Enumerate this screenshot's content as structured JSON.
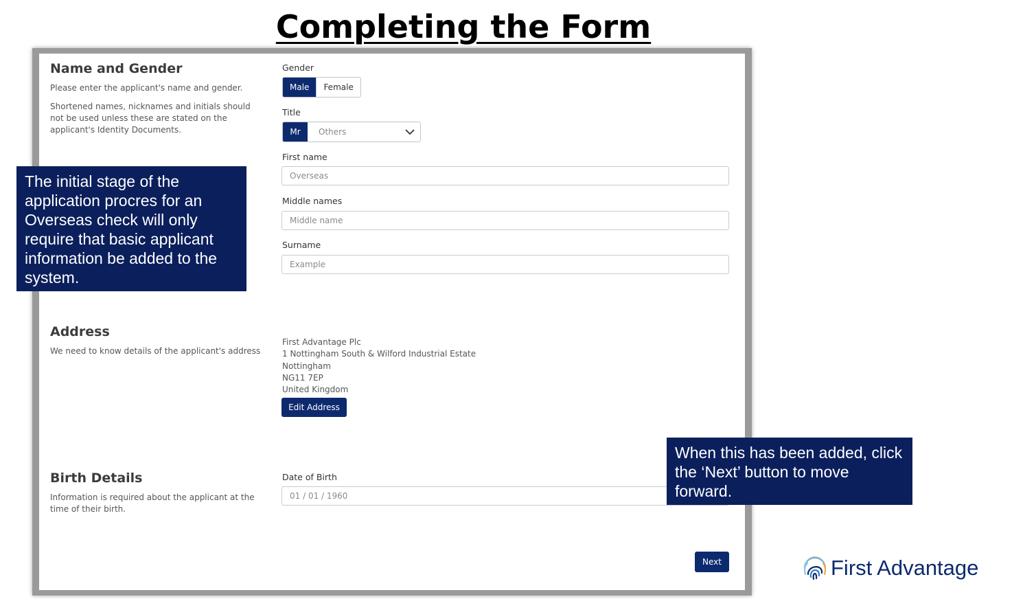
{
  "slide_title": "Completing the Form",
  "name_section": {
    "title": "Name and Gender",
    "desc1": "Please enter the applicant's name and gender.",
    "desc2": "Shortened names, nicknames and initials should not be used unless these are stated on the applicant's Identity Documents."
  },
  "gender": {
    "label": "Gender",
    "options": [
      "Male",
      "Female"
    ],
    "selected": "Male"
  },
  "title_field": {
    "label": "Title",
    "selected": "Mr",
    "dropdown_value": "Others"
  },
  "first_name": {
    "label": "First name",
    "value": "Overseas"
  },
  "middle_names": {
    "label": "Middle names",
    "placeholder": "Middle name"
  },
  "surname": {
    "label": "Surname",
    "value": "Example"
  },
  "address_section": {
    "title": "Address",
    "desc": "We need to know details of the applicant's address",
    "lines": [
      "First Advantage Plc",
      "1 Nottingham South & Wilford Industrial Estate",
      "Nottingham",
      "NG11 7EP",
      "United Kingdom"
    ],
    "edit_button": "Edit Address"
  },
  "birth_section": {
    "title": "Birth Details",
    "desc": "Information is required about the applicant at the time of their birth.",
    "dob_label": "Date of Birth",
    "dob_value": "01 / 01 / 1960"
  },
  "next_button": "Next",
  "callouts": {
    "left": "The initial stage of the application procres for an Overseas check will only require that basic applicant information be added to the system.",
    "right": "When this has been added, click the ‘Next’ button to move forward."
  },
  "logo": {
    "text": "First Advantage",
    "icon": "fingerprint-icon"
  },
  "colors": {
    "primary": "#0d2a6e",
    "callout": "#0b1f5c"
  }
}
